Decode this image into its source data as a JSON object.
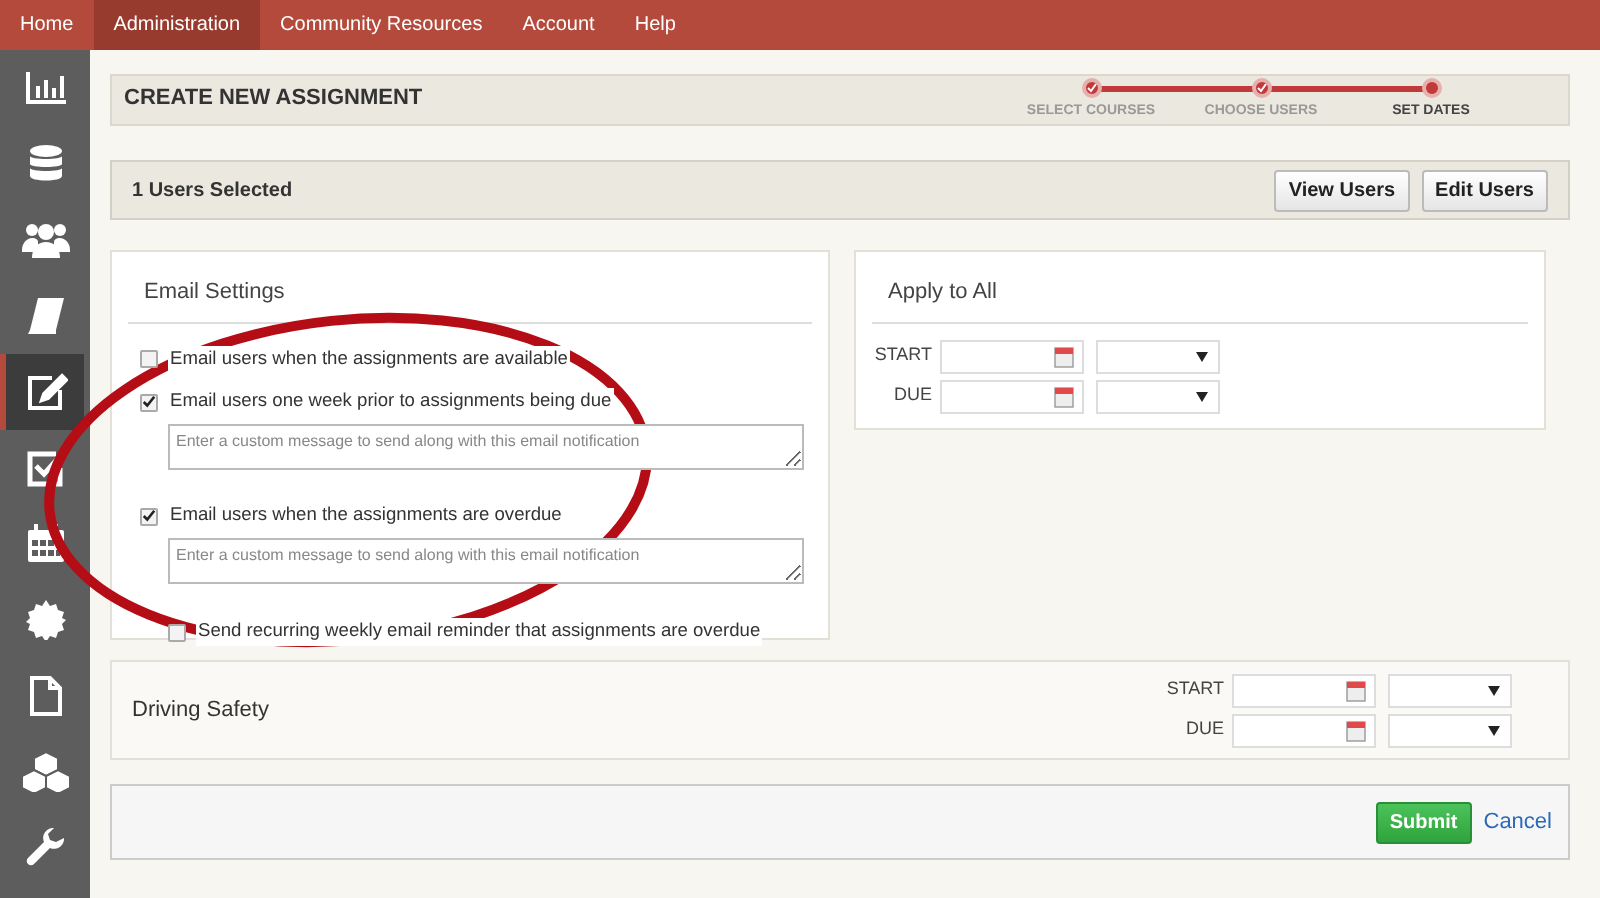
{
  "nav": [
    {
      "label": "Home",
      "selected": false
    },
    {
      "label": "Administration",
      "selected": true
    },
    {
      "label": "Community Resources",
      "selected": false
    },
    {
      "label": "Account",
      "selected": false
    },
    {
      "label": "Help",
      "selected": false
    }
  ],
  "sidebar": [
    {
      "selected": false
    },
    {
      "selected": false
    },
    {
      "selected": false
    },
    {
      "selected": false
    },
    {
      "selected": true
    },
    {
      "selected": false
    },
    {
      "selected": false
    },
    {
      "selected": false
    },
    {
      "selected": false
    },
    {
      "selected": false
    },
    {
      "selected": false
    }
  ],
  "header": {
    "title": "CREATE NEW ASSIGNMENT",
    "steps": [
      {
        "label": "SELECT COURSES",
        "done": true,
        "selected": false
      },
      {
        "label": "CHOOSE USERS",
        "done": true,
        "selected": false
      },
      {
        "label": "SET DATES",
        "done": false,
        "selected": true
      }
    ]
  },
  "users_bar": {
    "text": "1 Users Selected",
    "buttons": [
      "View Users",
      "Edit Users"
    ]
  },
  "email_settings": {
    "title": "Email Settings",
    "options": [
      {
        "kind": "option",
        "label": "Email users when the assignments are available",
        "checked": false
      },
      {
        "kind": "option",
        "label": "Email users one week prior to assignments being due",
        "checked": true,
        "message_placeholder": "Enter a custom message to send along with this email notification"
      },
      {
        "kind": "option",
        "label": "Email users when the assignments are overdue",
        "checked": true,
        "message_placeholder": "Enter a custom message to send along with this email notification"
      },
      {
        "kind": "sub-option",
        "label": "Send recurring weekly email reminder that assignments are overdue",
        "checked": false
      }
    ]
  },
  "apply_to_all": {
    "title": "Apply to All",
    "dates": [
      {
        "label": "START"
      },
      {
        "label": "DUE"
      }
    ]
  },
  "courses": [
    {
      "name": "Driving Safety",
      "dates": [
        {
          "label": "START"
        },
        {
          "label": "DUE"
        }
      ]
    }
  ],
  "actions": {
    "submit": "Submit",
    "cancel": "Cancel"
  },
  "annotations": [
    {
      "kind": "ellipse"
    }
  ]
}
